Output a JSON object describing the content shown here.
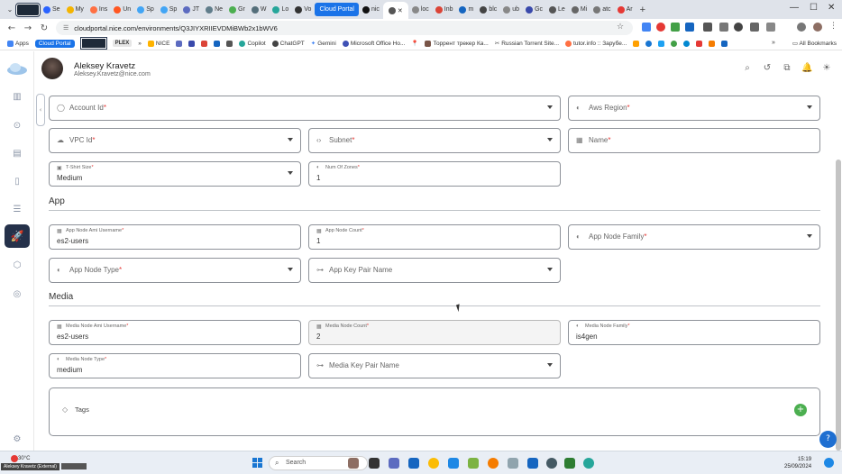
{
  "browser": {
    "tabs": [
      "Se",
      "My",
      "Ins",
      "Un",
      "Sp",
      "Sp",
      "JT",
      "Ne",
      "Gr",
      "W",
      "Lo",
      "Vo",
      "Cloud Portal",
      "nic",
      "",
      "loc",
      "Inb",
      "m",
      "blc",
      "ub",
      "Gc",
      "Le",
      "Mi",
      "atc",
      "Ar"
    ],
    "new_tab": "+",
    "url": "cloudportal.nice.com/environments/Q3JIYXRIIEVDMiBWb2x1bWV6",
    "bookmarks": {
      "apps": "Apps",
      "cloud_portal": "Cloud Portal",
      "plex": "PLEX",
      "nice": "NICE",
      "copilot": "Copilot",
      "chatgpt": "ChatGPT",
      "gemini": "Gemini",
      "microsoft_office": "Microsoft Office Ho...",
      "torrent_tracker": "Торрент трекер Ка...",
      "russian_torrent": "Russian Torrent Site...",
      "tutor": "tutor.info :: Зарубе...",
      "more": "»",
      "all_bookmarks": "All Bookmarks"
    }
  },
  "user": {
    "name": "Aleksey Kravetz",
    "email": "Aleksey.Kravetz@nice.com"
  },
  "form": {
    "account_id": "Account Id",
    "aws_region": "Aws Region",
    "vpc_id": "VPC Id",
    "subnet": "Subnet",
    "name": "Name",
    "tshirt_size": {
      "label": "T-Shirt Size",
      "value": "Medium"
    },
    "num_of_zones": {
      "label": "Num Of Zones",
      "value": "1"
    },
    "app": {
      "title": "App",
      "ami_username": {
        "label": "App Node Ami Username",
        "value": "es2-users"
      },
      "node_count": {
        "label": "App Node Count",
        "value": "1"
      },
      "node_family": "App Node Family",
      "node_type": "App Node Type",
      "key_pair": "App Key Pair Name"
    },
    "media": {
      "title": "Media",
      "ami_username": {
        "label": "Media Node Ami Username",
        "value": "es2-users"
      },
      "node_count": {
        "label": "Media Node Count",
        "value": "2"
      },
      "node_family": {
        "label": "Media Node Family",
        "value": "is4gen"
      },
      "node_type": {
        "label": "Media Node Type",
        "value": "medium"
      },
      "key_pair": "Media Key Pair Name"
    },
    "tags": "Tags",
    "required_mark": "*"
  },
  "taskbar": {
    "weather": "30°C",
    "external_label": "Aleksey Kravetz (External)",
    "search": "Search",
    "time": "15:19",
    "date": "25/09/2024"
  },
  "colors": {
    "rocket_bg": "#25314a",
    "tag_add": "#4caf50",
    "help": "#1f6fd1",
    "required": "#e53935"
  }
}
